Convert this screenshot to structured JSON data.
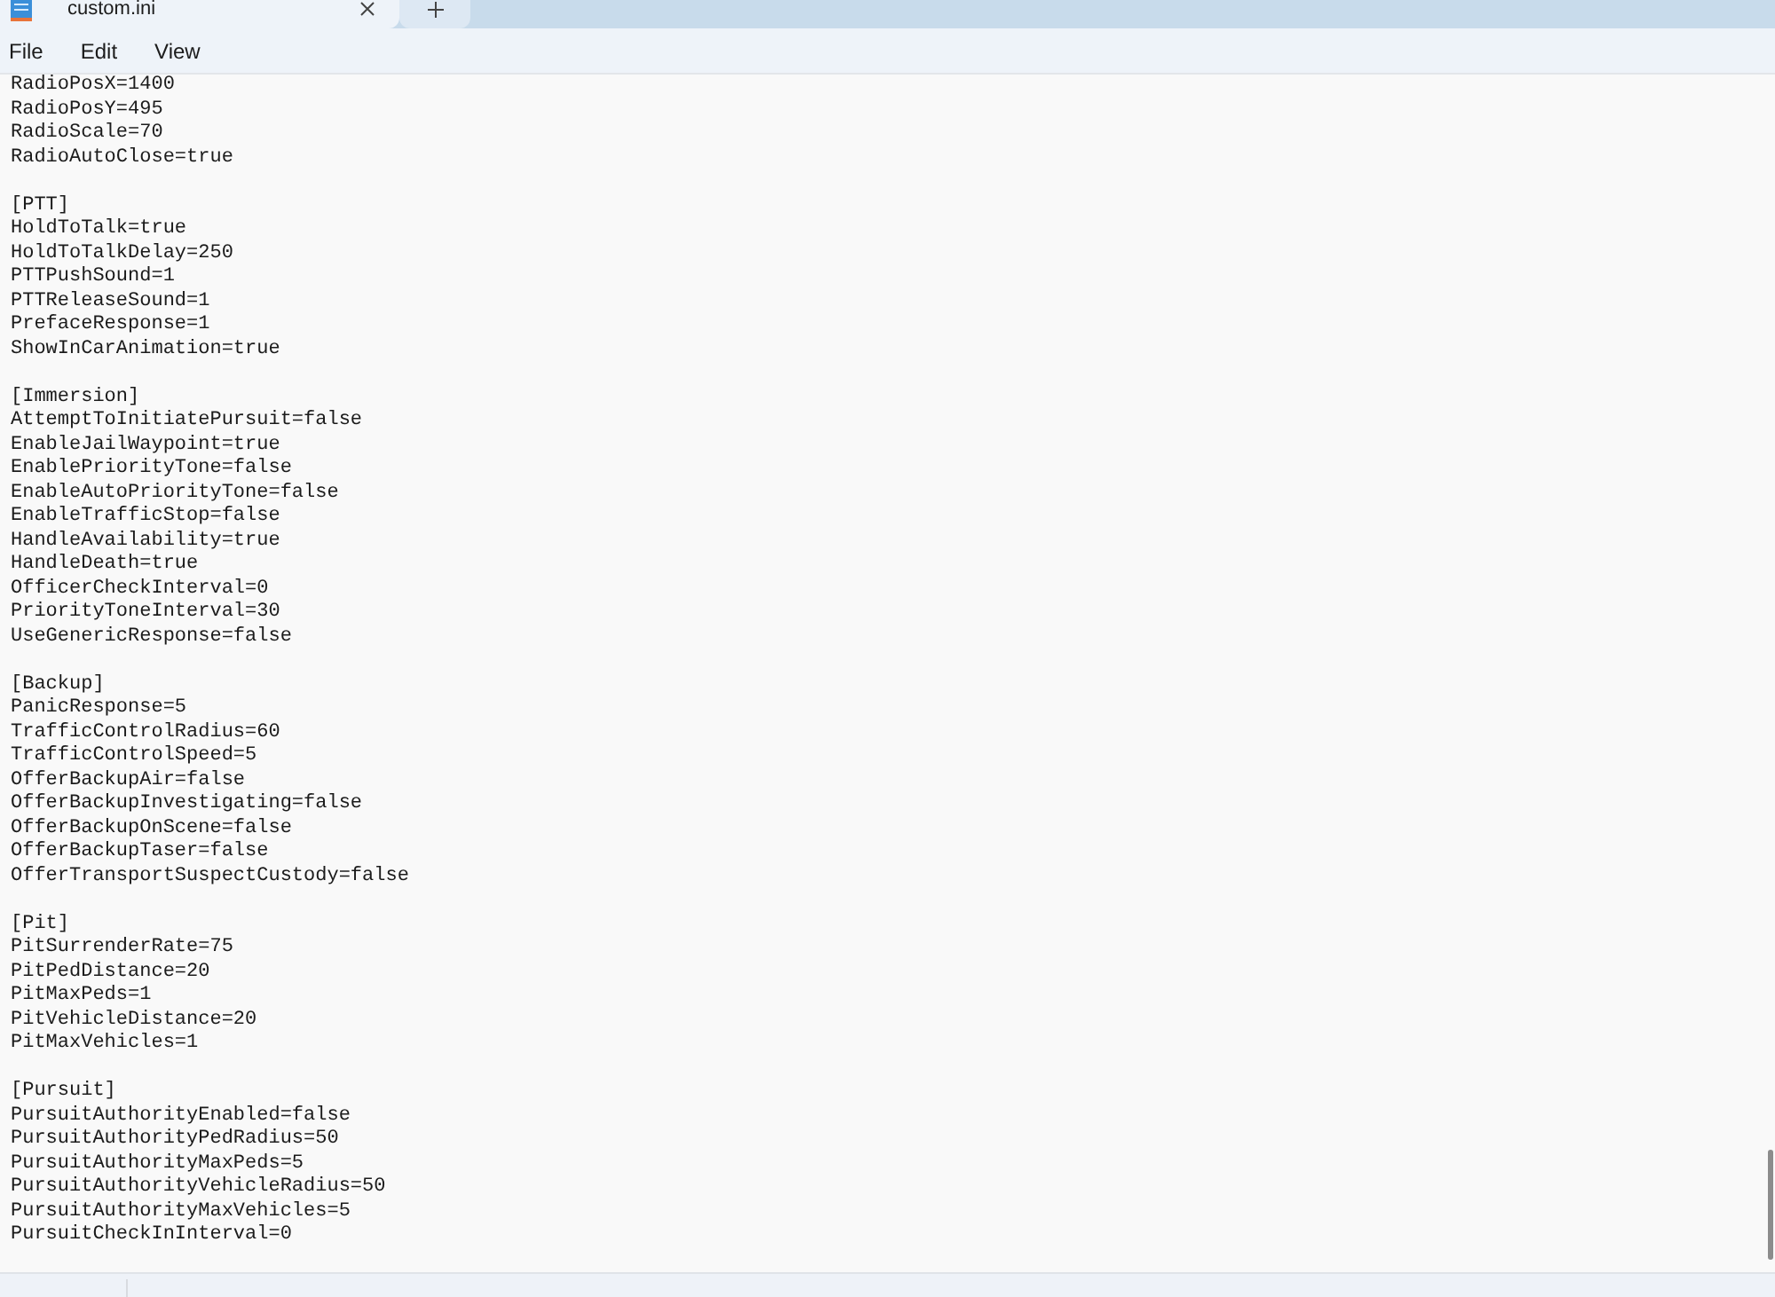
{
  "tabs": [
    {
      "label": "custom.ini",
      "selected": true
    }
  ],
  "menu": [
    {
      "label": "File"
    },
    {
      "label": "Edit"
    },
    {
      "label": "View"
    }
  ],
  "editor": {
    "sections": [
      {
        "lines": [
          "RadioPosX=1400",
          "RadioPosY=495",
          "RadioScale=70",
          "RadioAutoClose=true"
        ]
      },
      {
        "header": "[PTT]",
        "lines": [
          "HoldToTalk=true",
          "HoldToTalkDelay=250",
          "PTTPushSound=1",
          "PTTReleaseSound=1",
          "PrefaceResponse=1",
          "ShowInCarAnimation=true"
        ]
      },
      {
        "header": "[Immersion]",
        "lines": [
          "AttemptToInitiatePursuit=false",
          "EnableJailWaypoint=true",
          "EnablePriorityTone=false",
          "EnableAutoPriorityTone=false",
          "EnableTrafficStop=false",
          "HandleAvailability=true",
          "HandleDeath=true",
          "OfficerCheckInterval=0",
          "PriorityToneInterval=30",
          "UseGenericResponse=false"
        ]
      },
      {
        "header": "[Backup]",
        "lines": [
          "PanicResponse=5",
          "TrafficControlRadius=60",
          "TrafficControlSpeed=5",
          "OfferBackupAir=false",
          "OfferBackupInvestigating=false",
          "OfferBackupOnScene=false",
          "OfferBackupTaser=false",
          "OfferTransportSuspectCustody=false"
        ]
      },
      {
        "header": "[Pit]",
        "lines": [
          "PitSurrenderRate=75",
          "PitPedDistance=20",
          "PitMaxPeds=1",
          "PitVehicleDistance=20",
          "PitMaxVehicles=1"
        ]
      },
      {
        "header": "[Pursuit]",
        "lines": [
          "PursuitAuthorityEnabled=false",
          "PursuitAuthorityPedRadius=50",
          "PursuitAuthorityMaxPeds=5",
          "PursuitAuthorityVehicleRadius=50",
          "PursuitAuthorityMaxVehicles=5",
          "PursuitCheckInInterval=0"
        ]
      }
    ]
  }
}
